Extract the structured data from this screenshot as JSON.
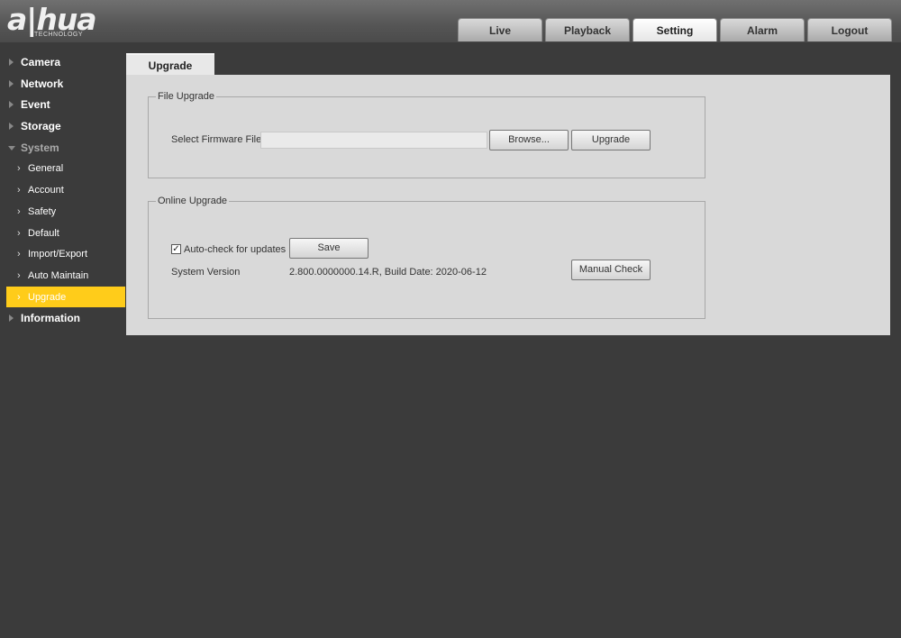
{
  "brand": {
    "name": "a|hua",
    "sub": "TECHNOLOGY"
  },
  "nav_tabs": [
    "Live",
    "Playback",
    "Setting",
    "Alarm",
    "Logout"
  ],
  "active_nav": "Setting",
  "sidebar": {
    "top_items": [
      "Camera",
      "Network",
      "Event",
      "Storage"
    ],
    "expanded_item": "System",
    "sub_items": [
      "General",
      "Account",
      "Safety",
      "Default",
      "Import/Export",
      "Auto Maintain",
      "Upgrade"
    ],
    "active_sub": "Upgrade",
    "bottom_items": [
      "Information"
    ]
  },
  "page": {
    "tab_title": "Upgrade",
    "file_upgrade": {
      "legend": "File Upgrade",
      "label": "Select Firmware File",
      "value": "",
      "browse_label": "Browse...",
      "upgrade_label": "Upgrade"
    },
    "online_upgrade": {
      "legend": "Online Upgrade",
      "autocheck_label": "Auto-check for updates",
      "autocheck_checked": true,
      "save_label": "Save",
      "version_label": "System Version",
      "version_value": "2.800.0000000.14.R, Build Date: 2020-06-12",
      "manual_check_label": "Manual Check"
    }
  },
  "colors": {
    "accent": "#ffcc1a",
    "background": "#3b3b3b",
    "panel": "#d9d9d9"
  }
}
